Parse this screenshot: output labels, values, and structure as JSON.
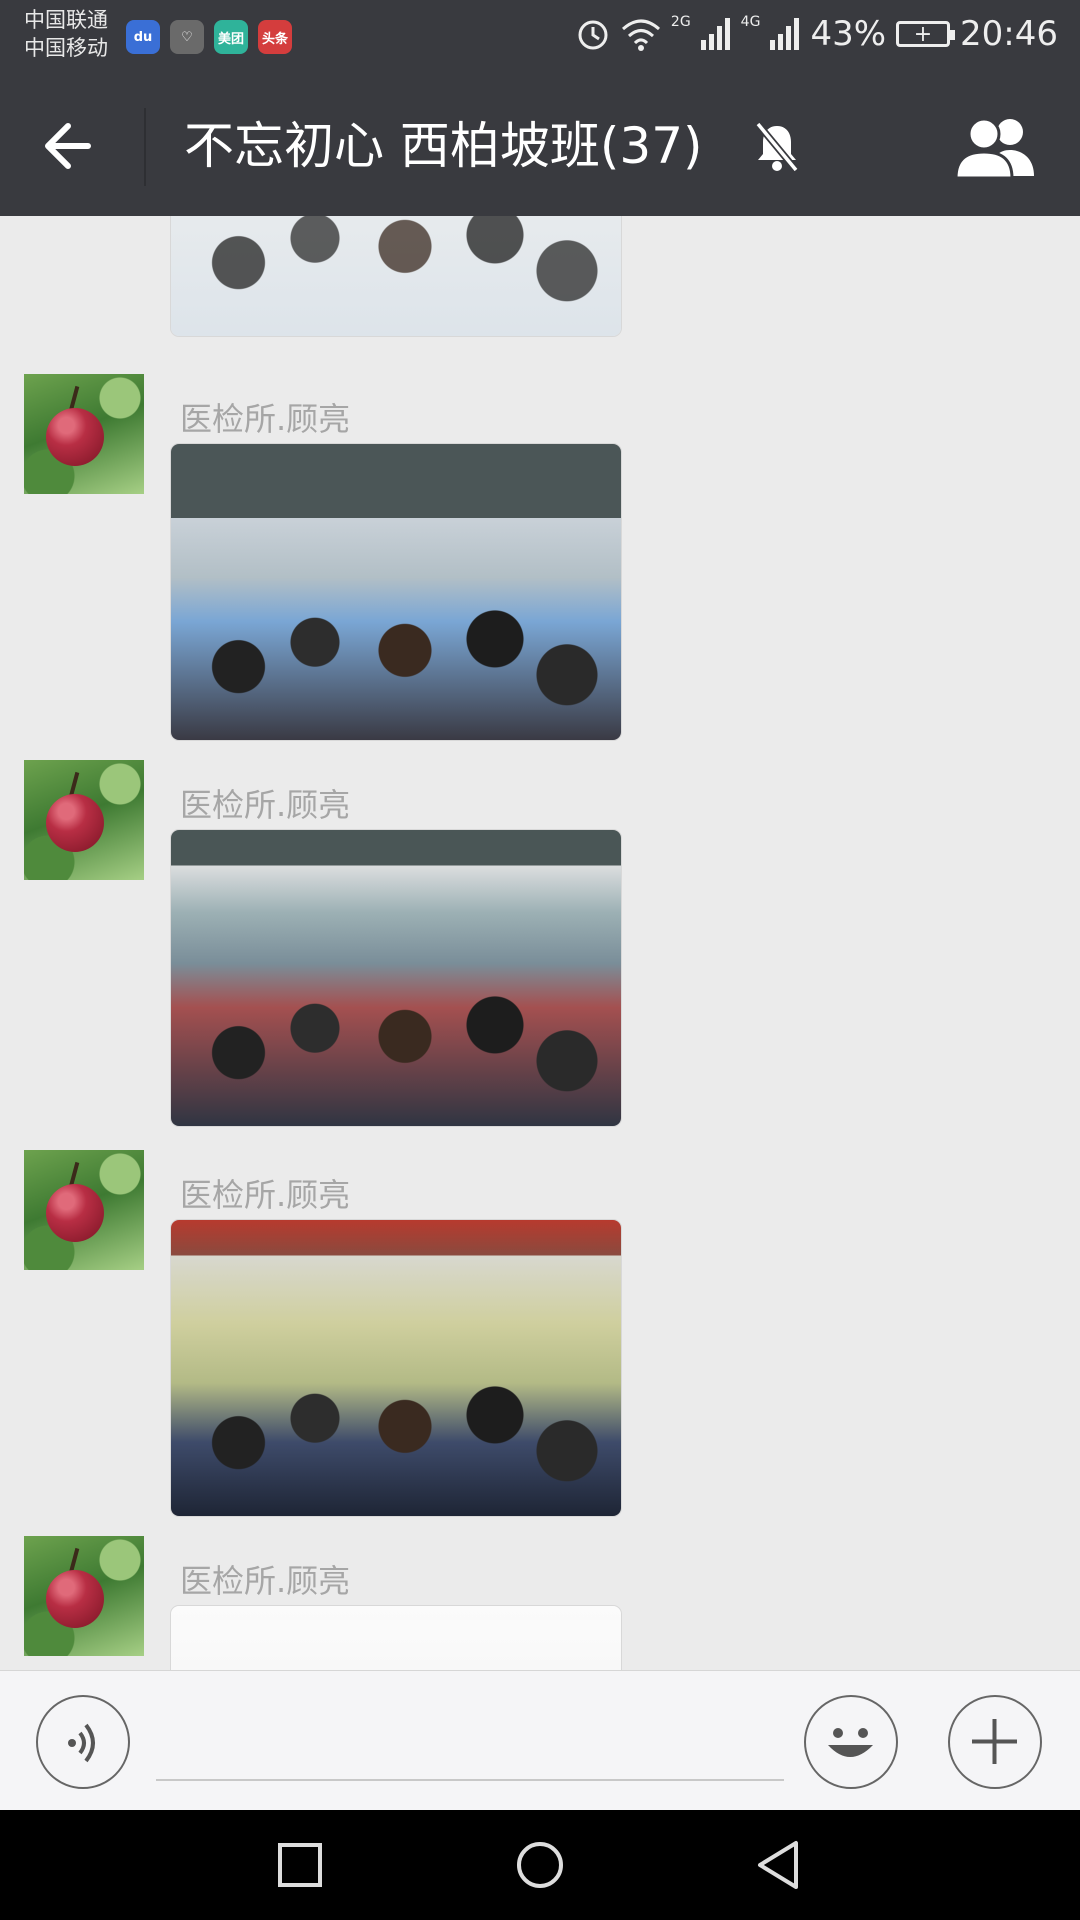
{
  "status_bar": {
    "carrier_1": "中国联通",
    "carrier_2": "中国移动",
    "apps": [
      {
        "icon": "baidu-icon",
        "label": "du",
        "color": "#3a6fd6"
      },
      {
        "icon": "health-icon",
        "label": "♡",
        "color": "#6a6a6a"
      },
      {
        "icon": "meituan-icon",
        "label": "美团",
        "color": "#2fb39a"
      },
      {
        "icon": "toutiao-icon",
        "label": "头条",
        "color": "#d43d3d"
      }
    ],
    "network_1": "2G",
    "network_2": "4G",
    "battery_percent": "43%",
    "time": "20:46"
  },
  "title_bar": {
    "title": "不忘初心  西柏坡班(37)"
  },
  "messages": [
    {
      "sender": "",
      "type": "image"
    },
    {
      "sender": "医检所.顾亮",
      "type": "image"
    },
    {
      "sender": "医检所.顾亮",
      "type": "image"
    },
    {
      "sender": "医检所.顾亮",
      "type": "image"
    },
    {
      "sender": "医检所.顾亮",
      "type": "image"
    }
  ],
  "input_bar": {
    "input_value": "",
    "input_placeholder": ""
  },
  "colors": {
    "header_bg": "#393a3f",
    "chat_bg": "#ebebeb",
    "sender_text": "#a6a6a6",
    "input_bg": "#f5f5f7",
    "nav_bg": "#000000"
  }
}
